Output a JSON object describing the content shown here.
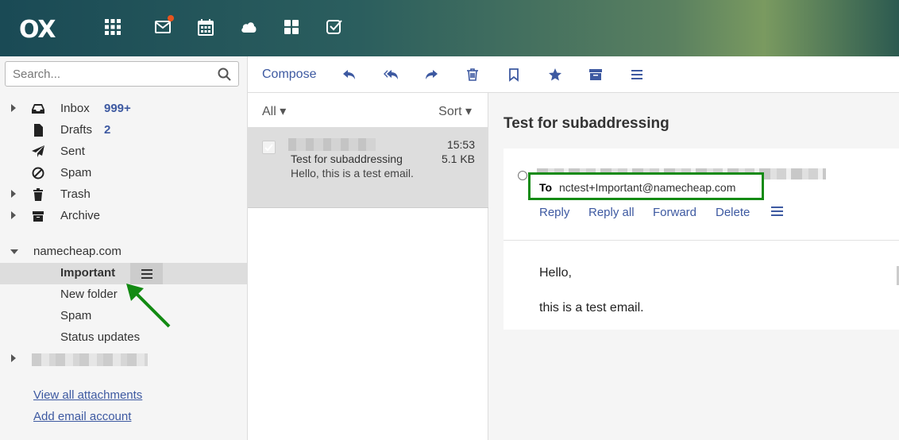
{
  "app": {
    "logo": "OX",
    "apps": [
      {
        "name": "app-launcher-icon"
      },
      {
        "name": "mail-icon",
        "has_notification": true
      },
      {
        "name": "calendar-icon"
      },
      {
        "name": "drive-cloud-icon"
      },
      {
        "name": "portal-tiles-icon"
      },
      {
        "name": "tasks-icon"
      }
    ],
    "colors": {
      "accent": "#3d59a1",
      "highlight_box": "#138a13",
      "notification": "#e8541e"
    }
  },
  "sidebar": {
    "search_placeholder": "Search...",
    "folders": [
      {
        "label": "Inbox",
        "count": "999+",
        "icon": "inbox-icon"
      },
      {
        "label": "Drafts",
        "count": "2",
        "icon": "drafts-icon"
      },
      {
        "label": "Sent",
        "icon": "sent-icon"
      },
      {
        "label": "Spam",
        "icon": "spam-icon"
      },
      {
        "label": "Trash",
        "icon": "trash-icon"
      },
      {
        "label": "Archive",
        "icon": "archive-icon"
      }
    ],
    "account": "namecheap.com",
    "subfolders": [
      {
        "label": "Important",
        "selected": true
      },
      {
        "label": "New folder"
      },
      {
        "label": "Spam"
      },
      {
        "label": "Status updates"
      }
    ],
    "links": [
      "View all attachments",
      "Add email account"
    ]
  },
  "toolbar": {
    "compose": "Compose",
    "icons": [
      "reply-icon",
      "reply-all-icon",
      "forward-icon",
      "delete-icon",
      "flag-icon",
      "star-icon",
      "archive-icon",
      "more-menu-icon"
    ]
  },
  "list": {
    "filter": "All",
    "sort": "Sort",
    "items": [
      {
        "time": "15:53",
        "size": "5.1 KB",
        "subject": "Test for subaddressing",
        "preview": "Hello, this is a test email."
      }
    ]
  },
  "detail": {
    "subject": "Test for subaddressing",
    "to_label": "To",
    "to_address": "nctest+Important@namecheap.com",
    "actions": [
      "Reply",
      "Reply all",
      "Forward",
      "Delete"
    ],
    "body": [
      "Hello,",
      "this is a test email."
    ]
  }
}
